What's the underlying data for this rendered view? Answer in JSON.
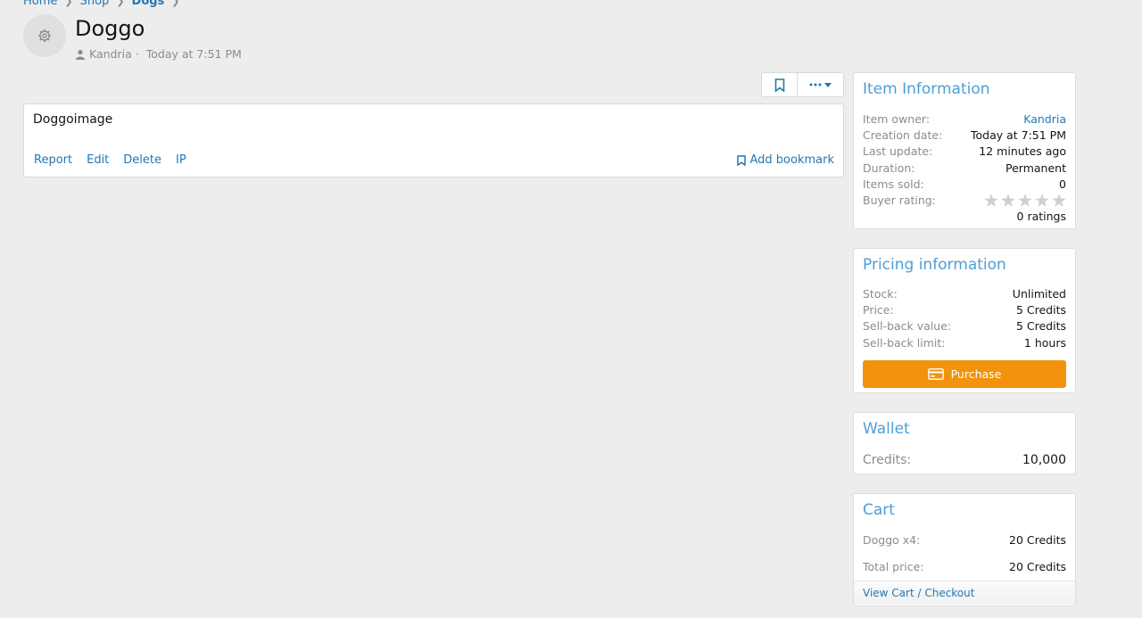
{
  "breadcrumb": {
    "items": [
      "Home",
      "Shop",
      "Dogs"
    ]
  },
  "header": {
    "title": "Doggo",
    "author": "Kandria",
    "date": "Today at 7:51 PM",
    "separator": "·"
  },
  "post": {
    "body": "Doggoimage",
    "actions": [
      "Report",
      "Edit",
      "Delete",
      "IP"
    ],
    "bookmark_label": "Add bookmark"
  },
  "item_information": {
    "title": "Item Information",
    "rows": [
      {
        "label": "Item owner:",
        "value": "Kandria"
      },
      {
        "label": "Creation date:",
        "value": "Today at 7:51 PM"
      },
      {
        "label": "Last update:",
        "value": "12 minutes ago"
      },
      {
        "label": "Duration:",
        "value": "Permanent"
      },
      {
        "label": "Items sold:",
        "value": "0"
      },
      {
        "label": "Buyer rating:",
        "value": ""
      }
    ],
    "rating_stars": 0,
    "ratings_count": "0 ratings"
  },
  "pricing": {
    "title": "Pricing information",
    "rows": [
      {
        "label": "Stock:",
        "value": "Unlimited"
      },
      {
        "label": "Price:",
        "value": "5 Credits"
      },
      {
        "label": "Sell-back value:",
        "value": "5 Credits"
      },
      {
        "label": "Sell-back limit:",
        "value": "1 hours"
      }
    ],
    "purchase_label": "Purchase"
  },
  "wallet": {
    "title": "Wallet",
    "label": "Credits:",
    "value": "10,000"
  },
  "cart": {
    "title": "Cart",
    "item_label": "Doggo x4:",
    "item_value": "20 Credits",
    "total_label": "Total price:",
    "total_value": "20 Credits",
    "checkout_label": "View Cart / Checkout"
  },
  "colors": {
    "accent": "#2577b1",
    "block_title": "#4d9fd6",
    "purchase": "#f2930d",
    "background": "#ededed"
  }
}
